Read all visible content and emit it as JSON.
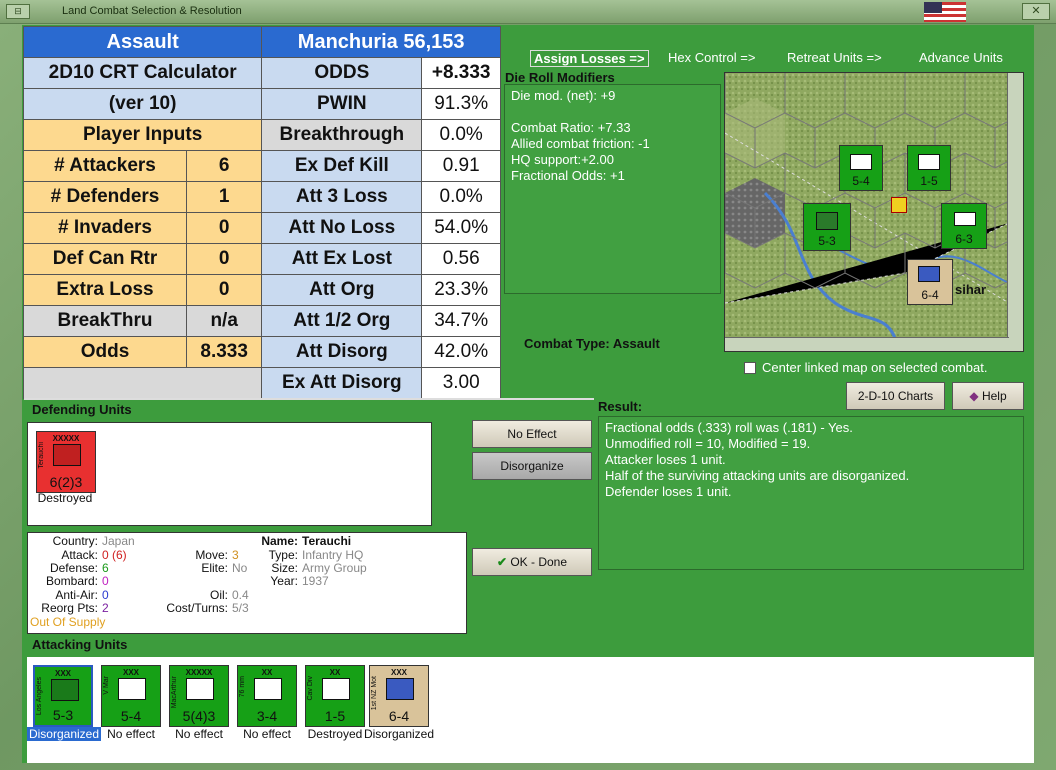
{
  "window": {
    "title": "Land Combat Selection & Resolution"
  },
  "crt": {
    "rows": [
      [
        "Assault",
        "Manchuria 56,153",
        ""
      ],
      [
        "2D10 CRT Calculator",
        "ODDS",
        "+8.333"
      ],
      [
        "(ver 10)",
        "PWIN",
        "91.3%"
      ],
      [
        "Player Inputs",
        "Breakthrough",
        "0.0%"
      ],
      [
        "# Attackers",
        "6",
        "Ex Def Kill",
        "0.91"
      ],
      [
        "# Defenders",
        "1",
        "Att 3 Loss",
        "0.0%"
      ],
      [
        "# Invaders",
        "0",
        "Att No Loss",
        "54.0%"
      ],
      [
        "Def Can Rtr",
        "0",
        "Att Ex Lost",
        "0.56"
      ],
      [
        "Extra Loss",
        "0",
        "Att Org",
        "23.3%"
      ],
      [
        "BreakThru",
        "n/a",
        "Att 1/2 Org",
        "34.7%"
      ],
      [
        "Odds",
        "8.333",
        "Att Disorg",
        "42.0%"
      ],
      [
        "",
        "",
        "Ex Att Disorg",
        "3.00"
      ]
    ]
  },
  "tabs": [
    "Assign Losses =>",
    "Hex Control =>",
    "Retreat Units =>",
    "Advance Units"
  ],
  "die_roll": {
    "title": "Die Roll Modifiers",
    "lines": [
      "Die mod. (net): +9",
      "",
      "Combat Ratio: +7.33",
      "Allied combat friction: -1",
      "HQ support:+2.00",
      "Fractional Odds: +1"
    ]
  },
  "map": {
    "place_label": "sihar",
    "counters": [
      "5-4",
      "1-5",
      "5-3",
      "6-3",
      "6-4"
    ]
  },
  "combat_type": {
    "label": "Combat Type:",
    "value": "Assault"
  },
  "center_checkbox": "Center linked map on selected combat.",
  "buttons": {
    "charts": "2-D-10 Charts",
    "help": "Help",
    "no_effect": "No Effect",
    "disorganize": "Disorganize",
    "ok": "OK - Done"
  },
  "result": {
    "label": "Result:",
    "lines": [
      "Fractional odds (.333) roll was (.181)  - Yes.",
      "Unmodified roll = 10, Modified = 19.",
      "Attacker loses 1 unit.",
      "Half of the surviving attacking units are disorganized.",
      "Defender loses 1 unit."
    ]
  },
  "defending": {
    "label": "Defending Units",
    "unit": {
      "name": "Terauchi",
      "size": "XXXXX",
      "strength": "6(2)3",
      "status": "Destroyed",
      "color": "#e83030"
    }
  },
  "info": {
    "country_l": "Country:",
    "country": "Japan",
    "attack_l": "Attack:",
    "attack": "0 (6)",
    "defense_l": "Defense:",
    "defense": "6",
    "bombard_l": "Bombard:",
    "bombard": "0",
    "antiair_l": "Anti-Air:",
    "antiair": "0",
    "reorg_l": "Reorg Pts:",
    "reorg": "2",
    "supply": "Out Of Supply",
    "move_l": "Move:",
    "move": "3",
    "elite_l": "Elite:",
    "elite": "No",
    "oil_l": "Oil:",
    "oil": "0.4",
    "cost_l": "Cost/Turns:",
    "cost": "5/3",
    "name_l": "Name:",
    "name": "Terauchi",
    "type_l": "Type:",
    "type": "Infantry HQ",
    "size_l": "Size:",
    "size": "Army Group",
    "year_l": "Year:",
    "year": "1937"
  },
  "attacking": {
    "label": "Attacking Units",
    "units": [
      {
        "name": "Los Angeles",
        "size": "XXX",
        "strength": "5-3",
        "status": "Disorganized",
        "color": "#16a016"
      },
      {
        "name": "V Mar",
        "size": "XXX",
        "strength": "5-4",
        "status": "No effect",
        "color": "#16a016"
      },
      {
        "name": "MacArthur",
        "size": "XXXXX",
        "strength": "5(4)3",
        "status": "No effect",
        "color": "#16a016"
      },
      {
        "name": "76 mm",
        "size": "XX",
        "strength": "3-4",
        "status": "No effect",
        "color": "#16a016"
      },
      {
        "name": "Cav Div",
        "size": "XX",
        "strength": "1-5",
        "status": "Destroyed",
        "color": "#16a016"
      },
      {
        "name": "1st NZ Mot",
        "size": "XXX",
        "strength": "6-4",
        "status": "Disorganized",
        "color": "#d9c39a"
      }
    ]
  }
}
